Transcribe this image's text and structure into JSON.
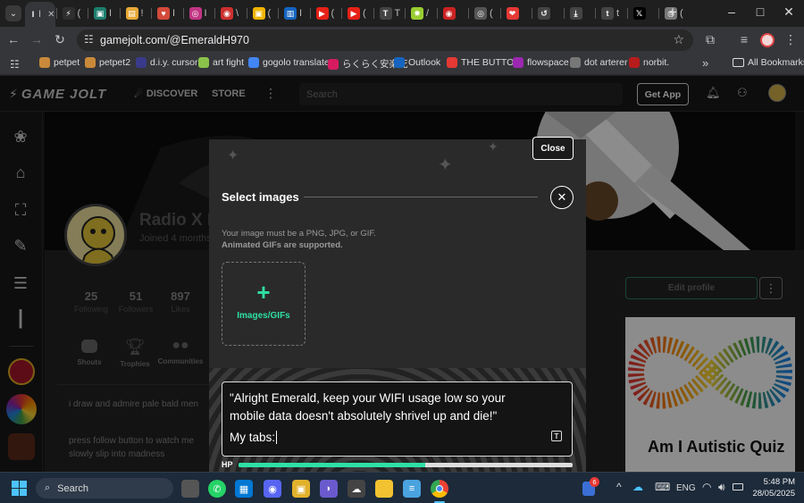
{
  "browser": {
    "tabs": [
      {
        "label": "I",
        "color": "#35363a",
        "icon": "gamejolt-icon"
      },
      {
        "label": "(",
        "color": "#2e2e2e",
        "icon": "gamejolt-icon"
      },
      {
        "label": "I",
        "color": "#1e7f6e",
        "icon": "tab-app-icon"
      },
      {
        "label": "!",
        "color": "#e8a838",
        "icon": "tab-app-icon"
      },
      {
        "label": "I",
        "color": "#d44a3a",
        "icon": "tab-app-icon"
      },
      {
        "label": "I",
        "color": "#c13584",
        "icon": "instagram-icon"
      },
      {
        "label": "\\",
        "color": "#cc2f2f",
        "icon": "tab-app-icon"
      },
      {
        "label": "(",
        "color": "#f0b400",
        "icon": "tab-app-icon"
      },
      {
        "label": "I",
        "color": "#1565c0",
        "icon": "outlook-icon"
      },
      {
        "label": "(",
        "color": "#e62117",
        "icon": "youtube-icon"
      },
      {
        "label": "(",
        "color": "#e62117",
        "icon": "youtube-icon"
      },
      {
        "label": "T",
        "color": "#444",
        "icon": "audio-icon"
      },
      {
        "label": "/",
        "color": "#9acd32",
        "icon": "tab-app-icon"
      },
      {
        "label": "",
        "color": "#cc2222",
        "icon": "tab-app-icon"
      },
      {
        "label": "(",
        "color": "#555",
        "icon": "tab-app-icon"
      },
      {
        "label": "",
        "color": "#e53935",
        "icon": "tab-app-icon"
      },
      {
        "label": "",
        "color": "#444",
        "icon": "history-icon"
      },
      {
        "label": "",
        "color": "#444",
        "icon": "download-icon"
      },
      {
        "label": "t",
        "color": "#444",
        "icon": "tab-app-icon"
      },
      {
        "label": "",
        "color": "#000",
        "icon": "x-icon"
      },
      {
        "label": "(",
        "color": "#777",
        "icon": "globe-icon"
      }
    ],
    "tab_glyphs": [
      "I",
      "⚡",
      "▣",
      "▤",
      "♥",
      "◎",
      "◉",
      "▣",
      "▥",
      "▶",
      "▶",
      "T",
      "✹",
      "◉",
      "◎",
      "❤",
      "↺",
      "⤓",
      "t",
      "𝕏",
      "◎"
    ],
    "new_tab_label": "+",
    "window_controls": {
      "minimize": "–",
      "maximize": "□",
      "close": "✕"
    },
    "url": "gamejolt.com/@EmeraldH970",
    "bookmarks": [
      {
        "label": "petpet",
        "color": "#c9893a"
      },
      {
        "label": "petpet2",
        "color": "#c9893a"
      },
      {
        "label": "d.i.y. cursor",
        "color": "#3a3a8a"
      },
      {
        "label": "art fight",
        "color": "#8bc34a"
      },
      {
        "label": "gogolo translate",
        "color": "#4285f4"
      },
      {
        "label": "らくらく安楽死",
        "color": "#d81b60"
      },
      {
        "label": "Outlook",
        "color": "#1565c0"
      },
      {
        "label": "THE BUTTON",
        "color": "#e53935"
      },
      {
        "label": "flowspace",
        "color": "#9c27b0"
      },
      {
        "label": "dot arterer",
        "color": "#777"
      },
      {
        "label": "norbit.",
        "color": "#b71c1c"
      }
    ],
    "bookmarks_more": "»",
    "all_bookmarks": "All Bookmarks"
  },
  "gamejolt": {
    "logo": "GAME JOLT",
    "nav_discover": "DISCOVER",
    "nav_store": "STORE",
    "search_placeholder": "Search",
    "get_app": "Get App",
    "profile": {
      "name": "Radio X I",
      "joined": "Joined 4 months",
      "stats": [
        {
          "value": "25",
          "label": "Following"
        },
        {
          "value": "51",
          "label": "Followers"
        },
        {
          "value": "897",
          "label": "Likes"
        }
      ],
      "tabs": [
        "Shouts",
        "Trophies",
        "Communities"
      ],
      "bio": [
        "i draw and admire pale bald men",
        "press follow button to watch me slowly slip into madness"
      ],
      "edit_profile": "Edit profile",
      "ad_title": "Am I Autistic Quiz"
    },
    "modal": {
      "close": "Close",
      "title": "Select images",
      "note_line1": "Your image must be a PNG, JPG, or GIF.",
      "note_line2": "Animated GIFs are supported.",
      "upload_plus": "+",
      "upload_label": "Images/GIFs"
    },
    "dialog": {
      "text": "\"Alright Emerald, keep your WIFI usage low so your mobile data doesn't absolutely shrivel up and die!\"",
      "input": "My tabs:",
      "hp_label": "HP",
      "hp_fraction": 0.56
    }
  },
  "taskbar": {
    "search": "Search",
    "language": "ENG",
    "time": "5:48 PM",
    "date": "28/05/2025",
    "notif_badge": "6",
    "tray_up": "^"
  },
  "colors": {
    "accent_green": "#2ee0a6",
    "gamejolt_bg": "#191919",
    "taskbar_bg": "#1c2a3a"
  }
}
